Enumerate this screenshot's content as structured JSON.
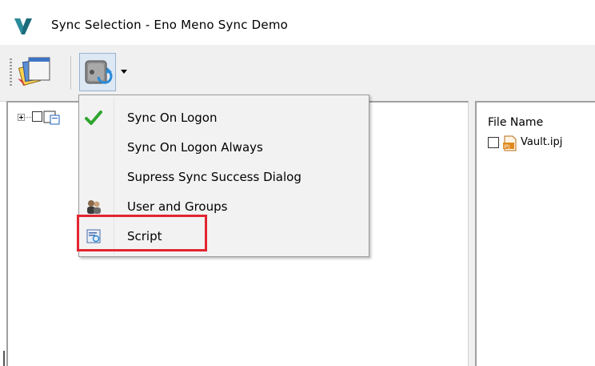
{
  "window": {
    "title": "Sync Selection - Eno Meno Sync Demo"
  },
  "toolbar": {
    "buttons": [
      {
        "name": "windows-button",
        "icon": "stacked-windows-icon"
      },
      {
        "name": "sync-button",
        "icon": "sync-server-icon",
        "has_dropdown": true
      }
    ]
  },
  "menu": {
    "items": [
      {
        "label": "Sync On Logon",
        "icon": "green-checkmark-icon",
        "checked": true
      },
      {
        "label": "Sync On Logon Always",
        "icon": ""
      },
      {
        "label": "Supress Sync Success Dialog",
        "icon": ""
      },
      {
        "label": "User and Groups",
        "icon": "users-icon"
      },
      {
        "label": "Script",
        "icon": "script-icon",
        "highlighted": true
      }
    ]
  },
  "file_list": {
    "header": "File Name",
    "rows": [
      {
        "name": "Vault.ipj",
        "icon_badge": "IPJ",
        "checked": false
      }
    ]
  },
  "colors": {
    "highlight_box": "#e32530",
    "check_green": "#2fa52f",
    "brand_v": "#1b6b7a",
    "ipj_orange": "#e08a1e"
  }
}
